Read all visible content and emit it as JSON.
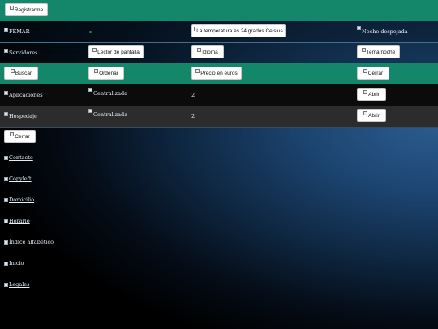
{
  "header": {
    "register_label": "Registrarme"
  },
  "row1": {
    "label": "FEMAR",
    "temperature_label": "La temperatura es 24 grados Celsius",
    "weather_label": "Noche despejada"
  },
  "row2": {
    "label": "Servidores",
    "screen_reader_label": "Lector de pantalla",
    "language_label": "Idioma",
    "theme_label": "Tema noche"
  },
  "row3": {
    "search_label": "Buscar",
    "sort_label": "Ordenar",
    "price_label": "Precio en euros",
    "close_label": "Cerrar"
  },
  "table": [
    {
      "name": "Aplicaciones",
      "type": "Centralizada",
      "count": "2",
      "action": "Abrir"
    },
    {
      "name": "Hospedaje",
      "type": "Centralizada",
      "count": "2",
      "action": "Abrir"
    }
  ],
  "close_panel_label": "Cerrar",
  "links": [
    "Contacto",
    "Copyleft",
    "Domicilio",
    "Horario",
    "Índice alfabético",
    "Inicio",
    "Legales"
  ],
  "colors": {
    "accent_green": "#14866a",
    "row_dark": "#0b0b0b",
    "row_gray": "#2c2c2c"
  }
}
